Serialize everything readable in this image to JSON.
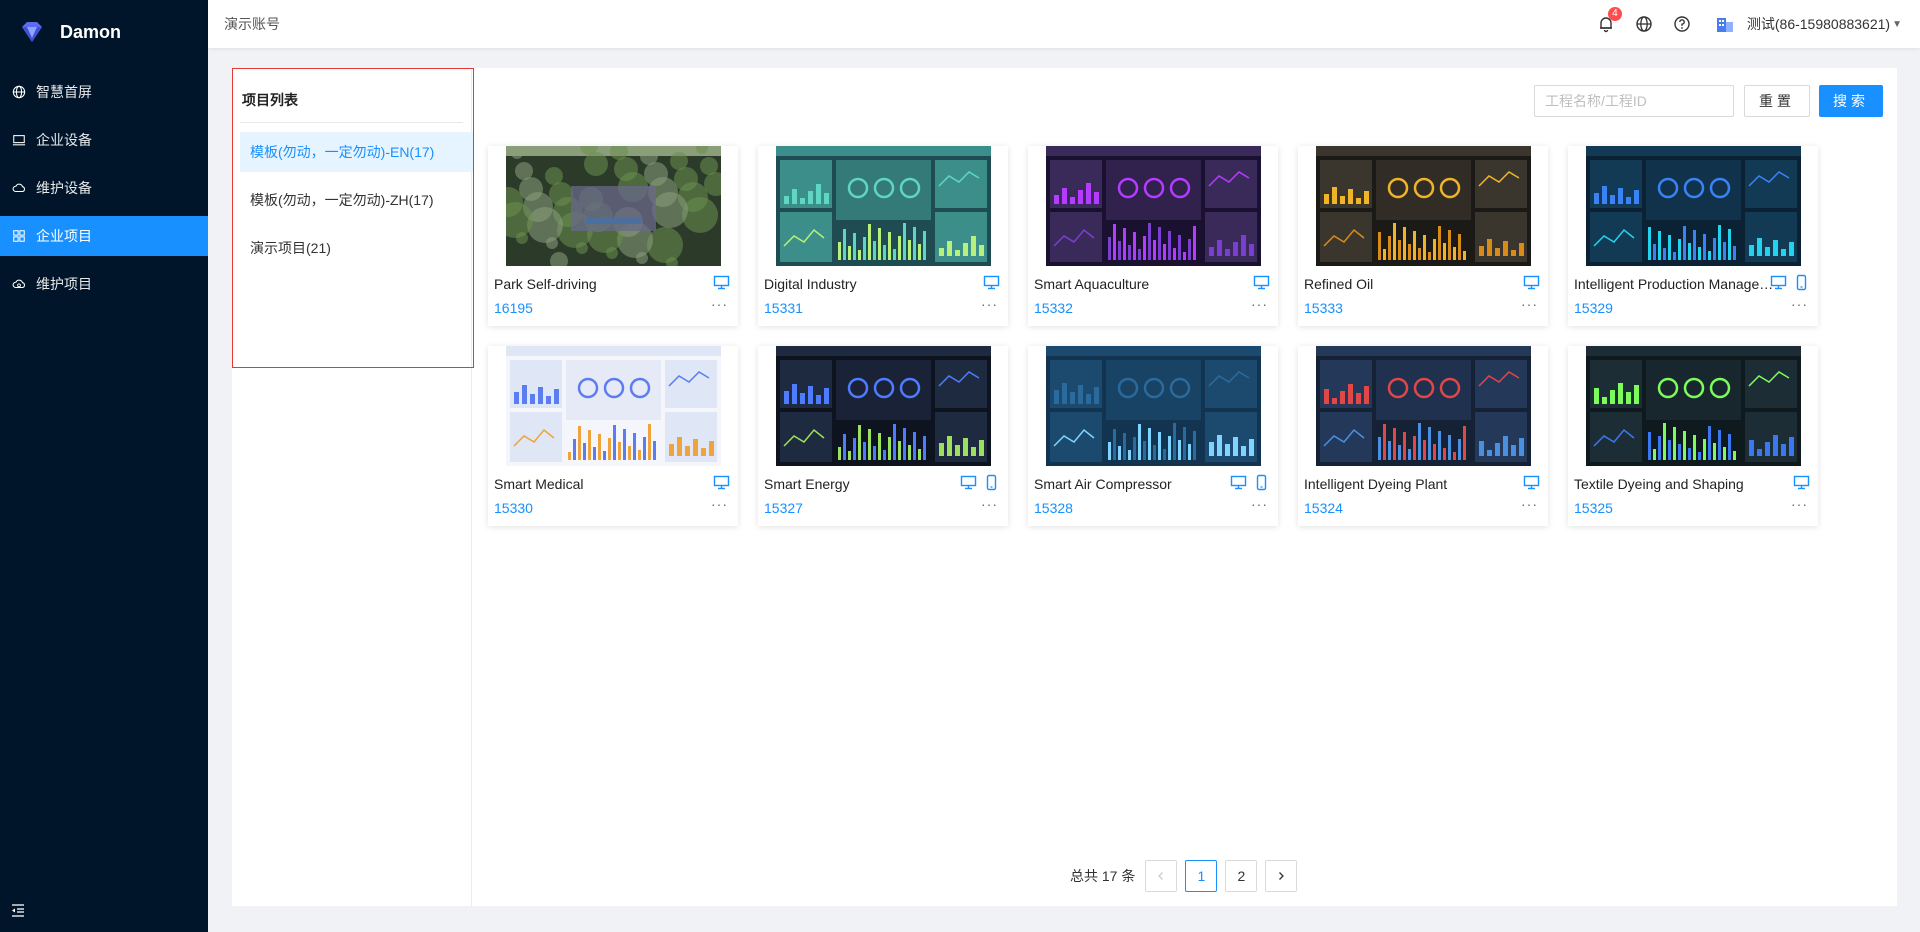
{
  "app": {
    "name": "Damon"
  },
  "sidebar": {
    "items": [
      {
        "label": "智慧首屏",
        "icon": "globe-icon",
        "active": false
      },
      {
        "label": "企业设备",
        "icon": "monitor-icon",
        "active": false
      },
      {
        "label": "维护设备",
        "icon": "cloud-icon",
        "active": false
      },
      {
        "label": "企业项目",
        "icon": "grid-icon",
        "active": true
      },
      {
        "label": "维护项目",
        "icon": "cloud-sync-icon",
        "active": false
      }
    ]
  },
  "header": {
    "breadcrumb": "演示账号",
    "notification_count": "4",
    "user": "测试(86-15980883621)"
  },
  "project_list": {
    "title": "项目列表",
    "items": [
      {
        "label": "模板(勿动，一定勿动)-EN(17)",
        "active": true
      },
      {
        "label": "模板(勿动，一定勿动)-ZH(17)",
        "active": false
      },
      {
        "label": "演示项目(21)",
        "active": false
      }
    ]
  },
  "search": {
    "placeholder": "工程名称/工程ID",
    "reset_label": "重置",
    "search_label": "搜索"
  },
  "cards": [
    {
      "name": "Park Self-driving",
      "id": "16195",
      "devices": [
        "pc"
      ],
      "theme": "photo"
    },
    {
      "name": "Digital Industry",
      "id": "15331",
      "devices": [
        "pc"
      ],
      "theme": "teal"
    },
    {
      "name": "Smart Aquaculture",
      "id": "15332",
      "devices": [
        "pc"
      ],
      "theme": "purple"
    },
    {
      "name": "Refined Oil",
      "id": "15333",
      "devices": [
        "pc"
      ],
      "theme": "amber"
    },
    {
      "name": "Intelligent Production Management",
      "id": "15329",
      "devices": [
        "pc",
        "mobile"
      ],
      "theme": "navy"
    },
    {
      "name": "Smart Medical",
      "id": "15330",
      "devices": [
        "pc"
      ],
      "theme": "light"
    },
    {
      "name": "Smart Energy",
      "id": "15327",
      "devices": [
        "pc",
        "mobile"
      ],
      "theme": "dark"
    },
    {
      "name": "Smart Air Compressor",
      "id": "15328",
      "devices": [
        "pc",
        "mobile"
      ],
      "theme": "blue"
    },
    {
      "name": "Intelligent Dyeing Plant",
      "id": "15324",
      "devices": [
        "pc"
      ],
      "theme": "map"
    },
    {
      "name": "Textile Dyeing and Shaping",
      "id": "15325",
      "devices": [
        "pc"
      ],
      "theme": "green"
    }
  ],
  "pagination": {
    "total_text": "总共 17 条",
    "pages": [
      "1",
      "2"
    ],
    "current": "1"
  },
  "colors": {
    "primary": "#1890ff",
    "sidebar_bg": "#001529",
    "highlight_border": "#e53935",
    "badge": "#ff4d4f"
  }
}
